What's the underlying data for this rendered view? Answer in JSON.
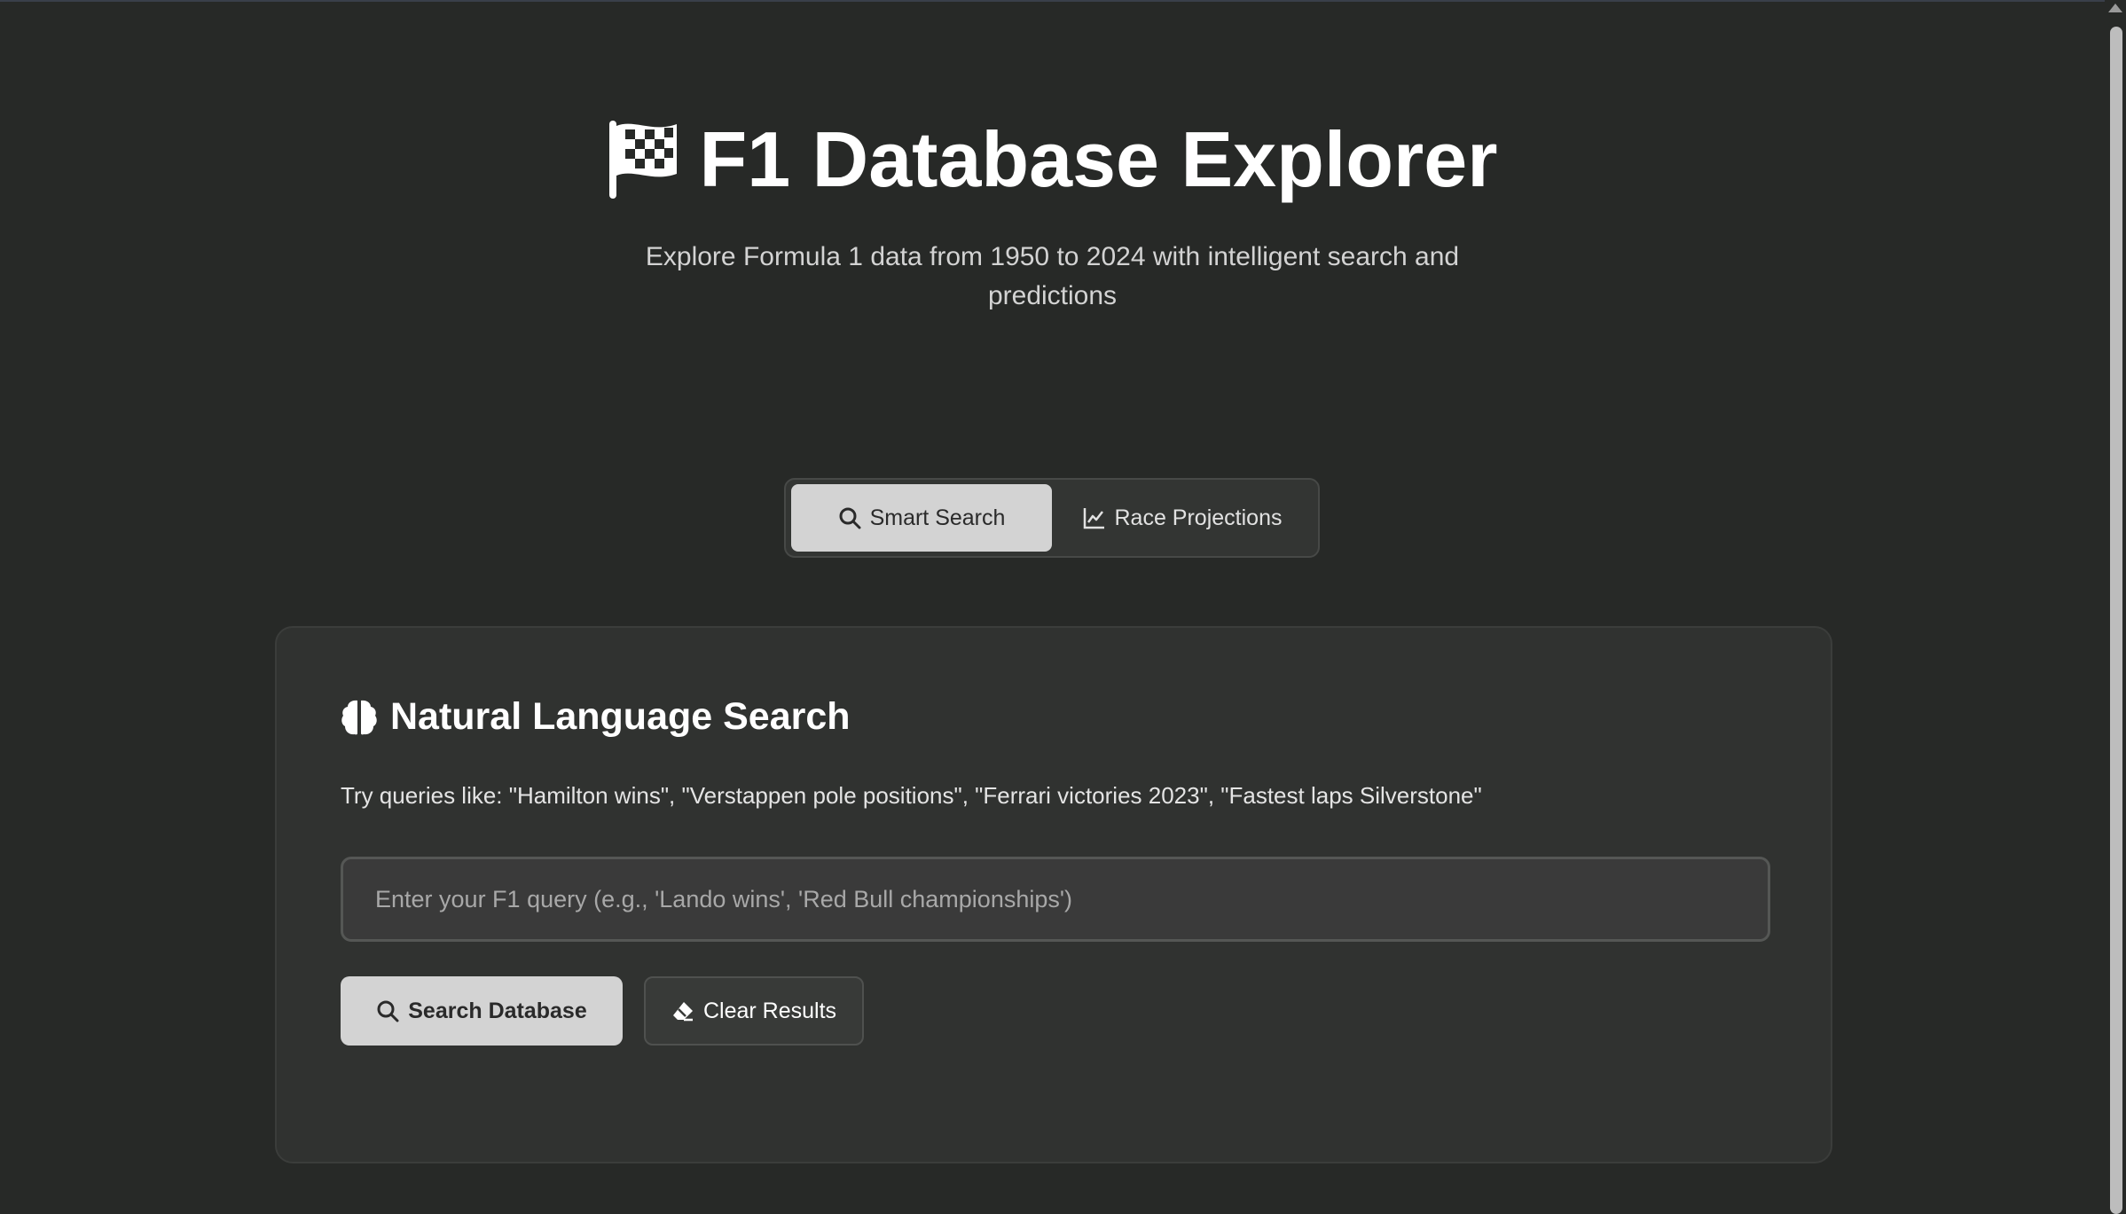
{
  "header": {
    "title": "F1 Database Explorer",
    "subtitle": "Explore Formula 1 data from 1950 to 2024 with intelligent search and predictions",
    "title_icon": "checkered-flag-icon"
  },
  "tabs": [
    {
      "label": "Smart Search",
      "icon": "search-icon",
      "active": true
    },
    {
      "label": "Race Projections",
      "icon": "chart-line-icon",
      "active": false
    }
  ],
  "search_panel": {
    "title": "Natural Language Search",
    "title_icon": "brain-icon",
    "hint": "Try queries like: \"Hamilton wins\", \"Verstappen pole positions\", \"Ferrari victories 2023\", \"Fastest laps Silverstone\"",
    "input_value": "",
    "input_placeholder": "Enter your F1 query (e.g., 'Lando wins', 'Red Bull championships')",
    "search_button": "Search Database",
    "clear_button": "Clear Results"
  },
  "colors": {
    "background": "#272927",
    "panel": "#303230",
    "accent_button": "#d3d3d3"
  }
}
